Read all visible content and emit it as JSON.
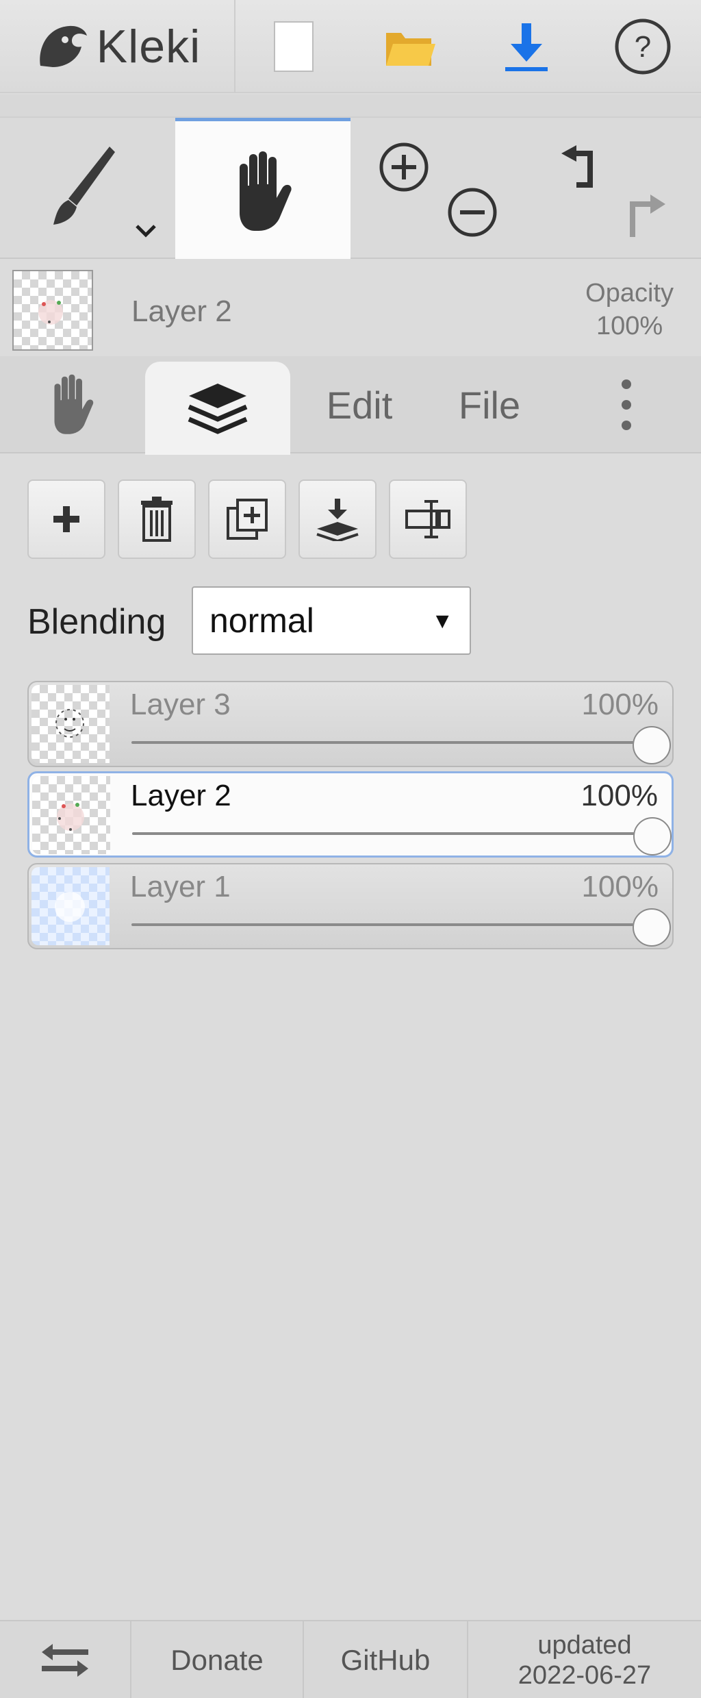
{
  "header": {
    "app_name": "Kleki",
    "icons": [
      "new-image-icon",
      "open-folder-icon",
      "download-icon",
      "help-icon"
    ]
  },
  "tools": {
    "brush_icon": "brush-icon",
    "hand_icon": "hand-icon",
    "zoom_in_icon": "zoom-in-icon",
    "zoom_out_icon": "zoom-out-icon",
    "undo_icon": "undo-icon",
    "redo_icon": "redo-icon",
    "active": "hand"
  },
  "current_layer": {
    "name": "Layer 2",
    "opacity_label": "Opacity",
    "opacity_value": "100%"
  },
  "tabs": {
    "edit": "Edit",
    "file": "File"
  },
  "layer_actions": [
    "add-layer",
    "delete-layer",
    "duplicate-layer",
    "merge-layer-down",
    "rename-layer"
  ],
  "blending": {
    "label": "Blending",
    "value": "normal",
    "arrow": "▼"
  },
  "layers": [
    {
      "name": "Layer 3",
      "opacity": "100%",
      "opacity_value": 1.0,
      "selected": false
    },
    {
      "name": "Layer 2",
      "opacity": "100%",
      "opacity_value": 1.0,
      "selected": true
    },
    {
      "name": "Layer 1",
      "opacity": "100%",
      "opacity_value": 1.0,
      "selected": false
    }
  ],
  "footer": {
    "donate": "Donate",
    "github": "GitHub",
    "updated_label": "updated",
    "updated_date": "2022-06-27"
  },
  "colors": {
    "accent_blue": "#1a73e8",
    "folder_yellow": "#f5c242",
    "selection_border": "#8fb2e6"
  }
}
